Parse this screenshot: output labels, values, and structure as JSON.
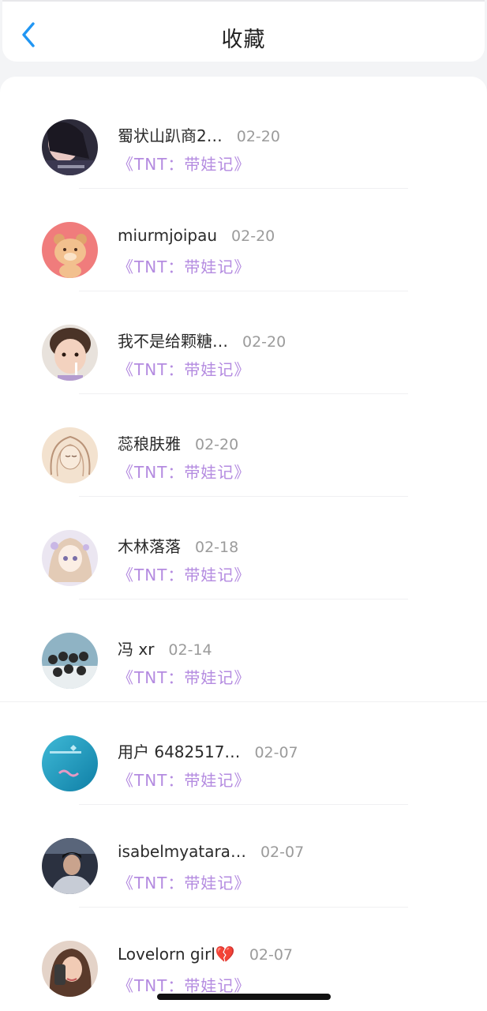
{
  "header": {
    "title": "收藏",
    "back_icon": "chevron-left-icon",
    "accent_color": "#2196f3"
  },
  "favorites": [
    {
      "username": "蜀状山趴商2…",
      "date": "02-20",
      "work": "《TNT：带娃记》"
    },
    {
      "username": "miurmjoipau",
      "date": "02-20",
      "work": "《TNT：带娃记》"
    },
    {
      "username": "我不是给颗糖…",
      "date": "02-20",
      "work": "《TNT：带娃记》"
    },
    {
      "username": "蕊稂肤雅",
      "date": "02-20",
      "work": "《TNT：带娃记》"
    },
    {
      "username": "木林落落",
      "date": "02-18",
      "work": "《TNT：带娃记》"
    },
    {
      "username": "冯 xr",
      "date": "02-14",
      "work": "《TNT：带娃记》"
    },
    {
      "username": "用户 6482517…",
      "date": "02-07",
      "work": "《TNT：带娃记》"
    },
    {
      "username": "isabelmyatara…",
      "date": "02-07",
      "work": "《TNT：带娃记》"
    },
    {
      "username": "Lovelorn girl💔",
      "date": "02-07",
      "work": "《TNT：带娃记》"
    }
  ],
  "colors": {
    "work_title": "#b48be0",
    "date": "#9b9b9b",
    "username": "#2a2a2a"
  }
}
